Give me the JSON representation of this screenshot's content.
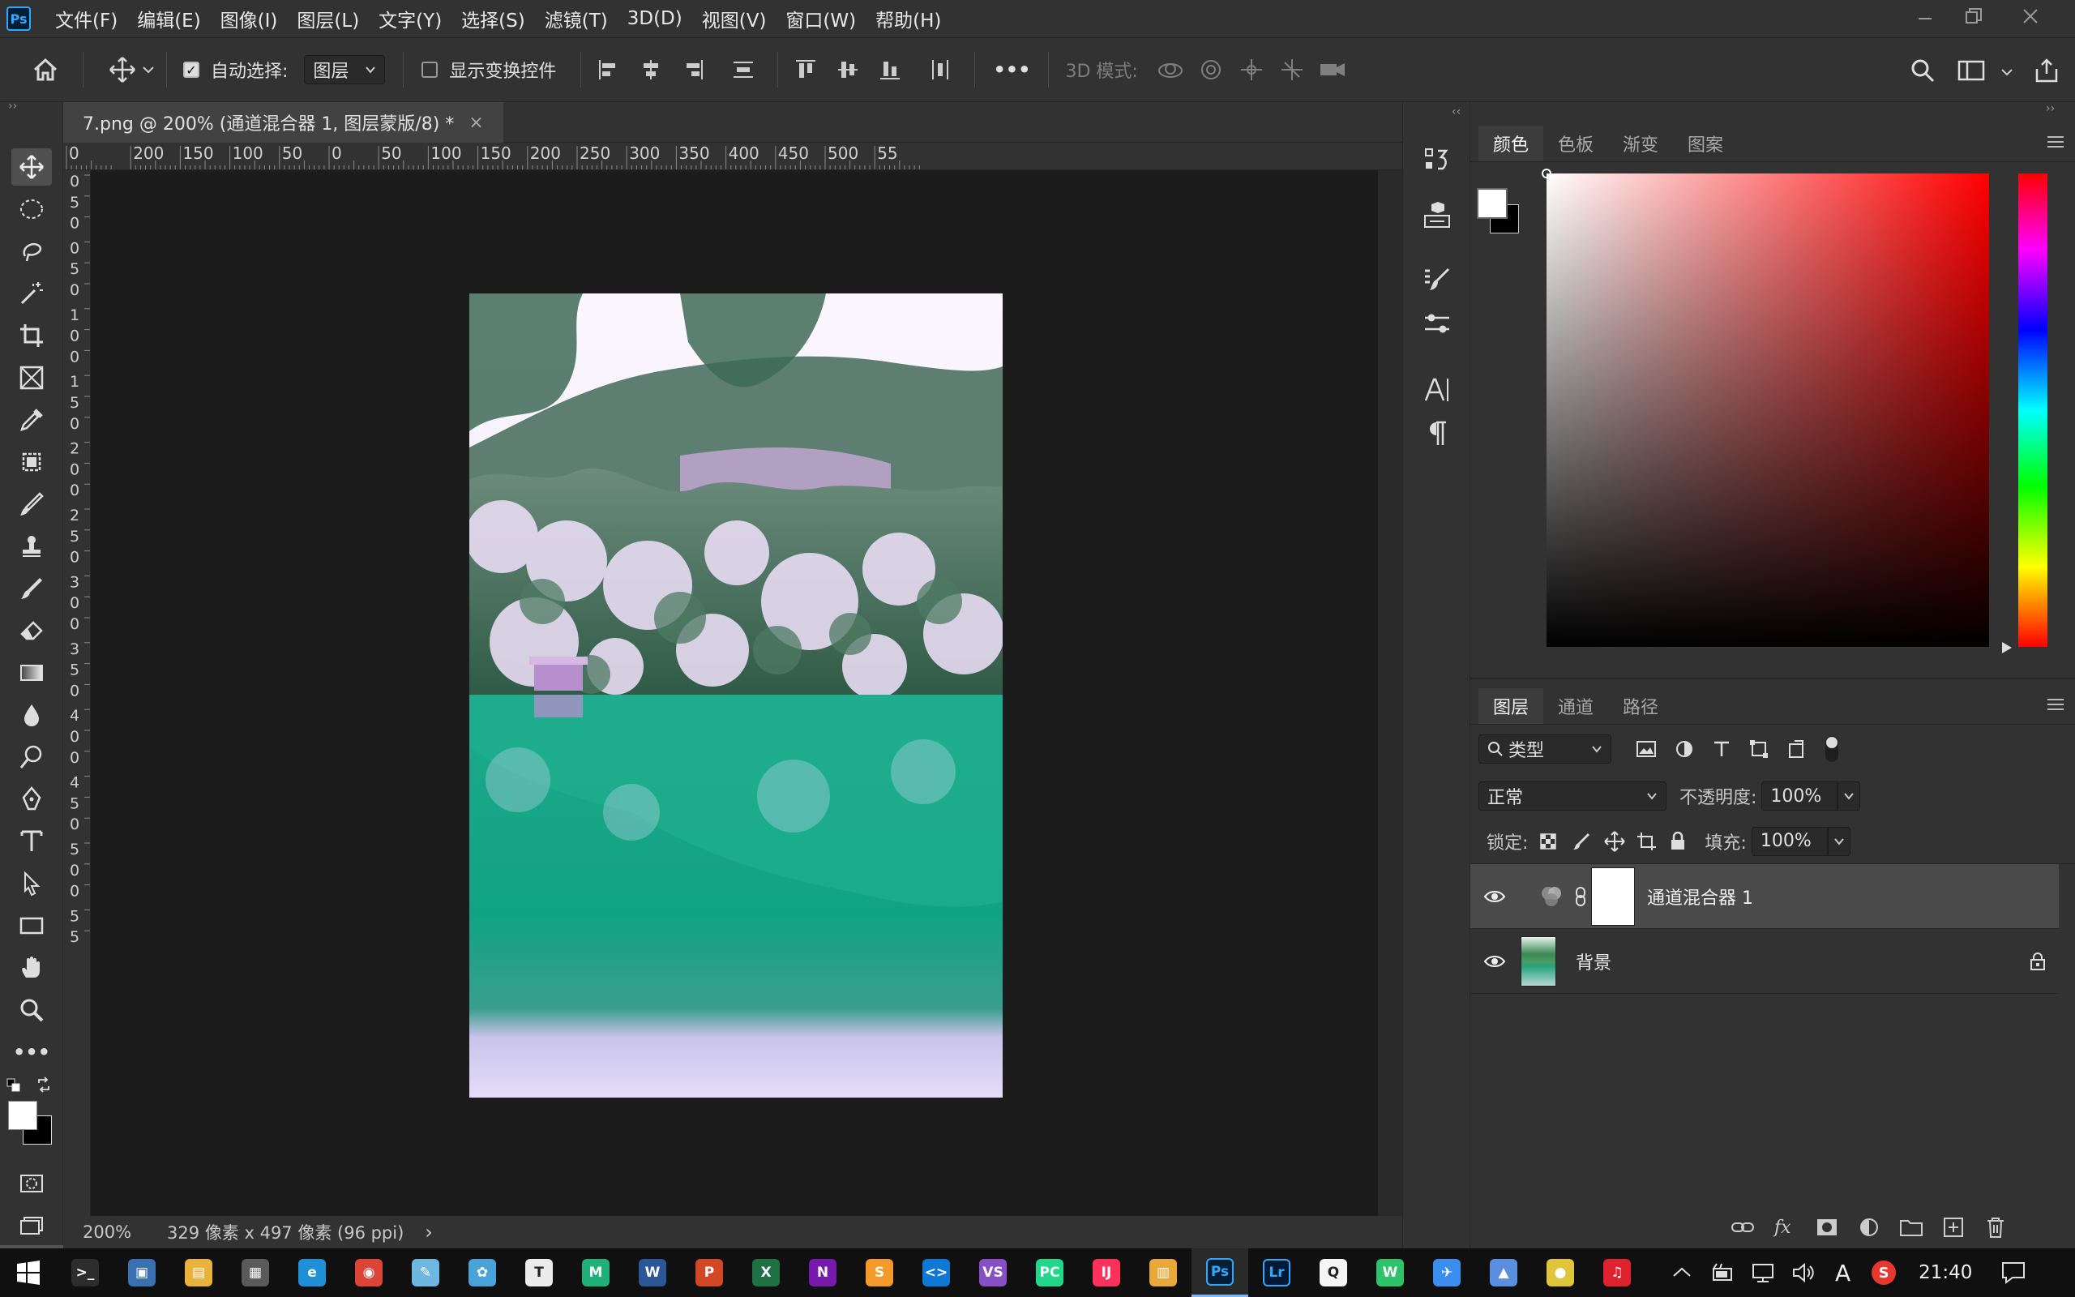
{
  "app": {
    "logo": "Ps"
  },
  "menu": [
    "文件(F)",
    "编辑(E)",
    "图像(I)",
    "图层(L)",
    "文字(Y)",
    "选择(S)",
    "滤镜(T)",
    "3D(D)",
    "视图(V)",
    "窗口(W)",
    "帮助(H)"
  ],
  "options": {
    "auto_select_label": "自动选择:",
    "auto_select_value": "图层",
    "show_transform_label": "显示变换控件",
    "three_d_mode_label": "3D 模式:",
    "more": "•••"
  },
  "document": {
    "tab_title": "7.png @ 200% (通道混合器 1, 图层蒙版/8) *",
    "close": "×",
    "ruler_h_labels": [
      "0",
      "200",
      "150",
      "100",
      "50",
      "0",
      "50",
      "100",
      "150",
      "200",
      "250",
      "300",
      "350",
      "400",
      "450",
      "500",
      "55"
    ],
    "ruler_v_labels": [
      "0",
      "5",
      "0",
      "0",
      "5",
      "0",
      "1",
      "0",
      "0",
      "1",
      "5",
      "0",
      "2",
      "0",
      "0",
      "2",
      "5",
      "0",
      "3",
      "0",
      "0",
      "3",
      "5",
      "0",
      "4",
      "0",
      "0",
      "4",
      "5",
      "0",
      "5",
      "0",
      "0",
      "5",
      "5"
    ],
    "zoom": "200%",
    "size_info": "329 像素 x 497 像素 (96 ppi)",
    "status_arrow": "›"
  },
  "panels": {
    "collapse_left": "‹‹",
    "collapse_right": "››",
    "color_tabs": [
      "颜色",
      "色板",
      "渐变",
      "图案"
    ],
    "layers_tabs": [
      "图层",
      "通道",
      "路径"
    ],
    "filter_kind": "类型",
    "blend_mode": "正常",
    "opacity_label": "不透明度:",
    "opacity_value": "100%",
    "lock_label": "锁定:",
    "fill_label": "填充:",
    "fill_value": "100%",
    "layers": [
      {
        "name": "通道混合器 1",
        "type": "adjustment",
        "visible": true,
        "selected": true
      },
      {
        "name": "背景",
        "type": "background",
        "visible": true,
        "locked": true
      }
    ]
  },
  "taskbar": {
    "time": "21:40",
    "ime": "A",
    "apps": [
      {
        "name": "terminal",
        "label": ">_",
        "color": "#2d2d2d"
      },
      {
        "name": "remote",
        "label": "▣",
        "color": "#3a6fb0"
      },
      {
        "name": "explorer",
        "label": "▤",
        "color": "#e9b33b"
      },
      {
        "name": "calculator",
        "label": "▦",
        "color": "#5a5a5a"
      },
      {
        "name": "edge",
        "label": "e",
        "color": "#1f8fd8"
      },
      {
        "name": "chrome",
        "label": "◉",
        "color": "#dc4437"
      },
      {
        "name": "notepad",
        "label": "✎",
        "color": "#6db7e0"
      },
      {
        "name": "pinwheel",
        "label": "✿",
        "color": "#4aa3d8"
      },
      {
        "name": "typora",
        "label": "T",
        "color": "#ececec"
      },
      {
        "name": "mindmap",
        "label": "M",
        "color": "#20b07a"
      },
      {
        "name": "word",
        "label": "W",
        "color": "#2b5797"
      },
      {
        "name": "powerpoint",
        "label": "P",
        "color": "#d24726"
      },
      {
        "name": "excel",
        "label": "X",
        "color": "#1e7145"
      },
      {
        "name": "onenote",
        "label": "N",
        "color": "#7719aa"
      },
      {
        "name": "sublime",
        "label": "S",
        "color": "#f39a2b"
      },
      {
        "name": "vscode",
        "label": "<>",
        "color": "#0e78d4"
      },
      {
        "name": "visualstudio",
        "label": "VS",
        "color": "#864fc6"
      },
      {
        "name": "pycharm",
        "label": "PC",
        "color": "#21d789"
      },
      {
        "name": "intellij",
        "label": "IJ",
        "color": "#fe315d"
      },
      {
        "name": "clipboard",
        "label": "▥",
        "color": "#e8a93a"
      },
      {
        "name": "photoshop",
        "label": "Ps",
        "color": "#001e36"
      },
      {
        "name": "lightroom",
        "label": "Lr",
        "color": "#001a36"
      },
      {
        "name": "qq",
        "label": "Q",
        "color": "#f5f5f5"
      },
      {
        "name": "wechat",
        "label": "W",
        "color": "#2ec26a"
      },
      {
        "name": "feishu",
        "label": "✈",
        "color": "#3b8ef0"
      },
      {
        "name": "store",
        "label": "▲",
        "color": "#5a8fe0"
      },
      {
        "name": "yellow-app",
        "label": "●",
        "color": "#e0c43a"
      },
      {
        "name": "netease-music",
        "label": "♫",
        "color": "#e0212e"
      }
    ]
  },
  "colors": {
    "accent": "#31a8ff",
    "fg_swatch": "#ffffff",
    "bg_swatch": "#000000"
  }
}
